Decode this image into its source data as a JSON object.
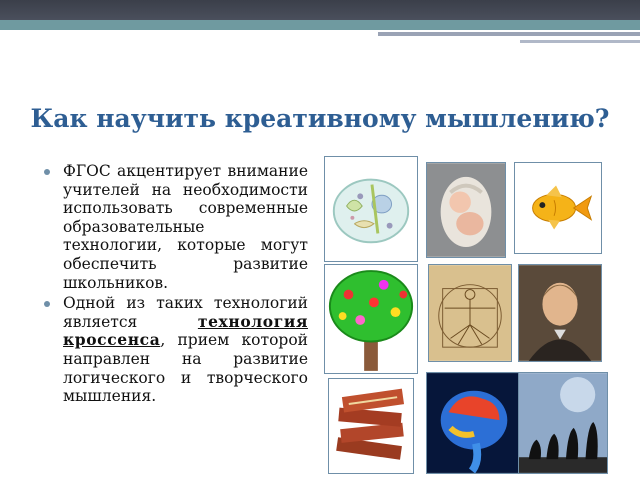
{
  "title": "Как научить креативному мышлению?",
  "bullets": [
    {
      "text": "ФГОС акцентирует внимание учителей на необходимости использовать современные образовательные технологии, которые могут обеспечить развитие школьников."
    },
    {
      "before": "Одной из таких технологий является ",
      "keyword": "технология кроссенса",
      "after": ", прием которой направлен на развитие логического и творческого мышления."
    }
  ],
  "colors": {
    "title": "#2e5e93",
    "bullet": "#6f8fa8",
    "frame": "#6f8fa8"
  },
  "images": [
    {
      "icon": "cell-icon"
    },
    {
      "icon": "baby-in-egg-icon"
    },
    {
      "icon": "goldfish-icon"
    },
    {
      "icon": "flower-tree-icon"
    },
    {
      "icon": "vitruvian-man-icon"
    },
    {
      "icon": "darwin-portrait-icon"
    },
    {
      "icon": "books-icon"
    },
    {
      "icon": "brain-icon"
    },
    {
      "icon": "evolution-icon"
    }
  ]
}
